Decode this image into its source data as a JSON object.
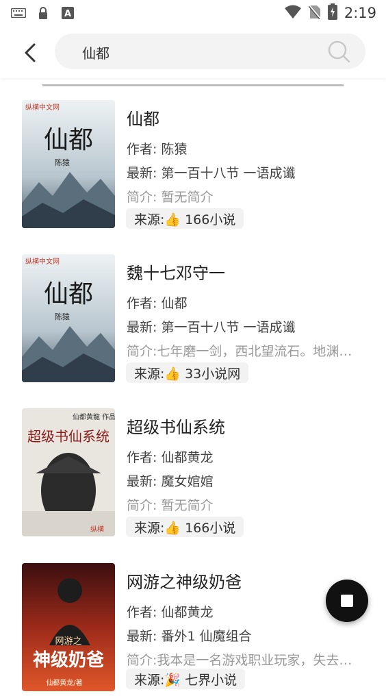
{
  "status_bar": {
    "time": "2:19",
    "left_icons": [
      "keyboard-icon",
      "lock-icon",
      "font-icon"
    ],
    "right_icons": [
      "wifi-icon",
      "no-sim-icon",
      "battery-charging-icon"
    ]
  },
  "header": {
    "search_value": "仙都"
  },
  "results": [
    {
      "title": "仙都",
      "author": "作者: 陈猿",
      "latest": "最新: 第一百十八节 一语成谶",
      "intro": "简介: 暂无简介",
      "source": "来源:👍 166小说",
      "cover": {
        "top": "纵横中文网",
        "main": "仙都",
        "author": "陈猿"
      }
    },
    {
      "title": "魏十七邓守一",
      "author": "作者: 仙都",
      "latest": "最新: 第一百十八节 一语成谶",
      "intro": "简介:七年磨一剑，西北望流石。地渊…",
      "source": "来源:👍 33小说网",
      "cover": {
        "top": "纵横中文网",
        "main": "仙都",
        "author": "陈猿"
      }
    },
    {
      "title": "超级书仙系统",
      "author": "作者: 仙都黄龙",
      "latest": "最新: 魔女婠婠",
      "intro": "简介: 暂无简介",
      "source": "来源:👍 166小说",
      "cover": {
        "top": "仙都黄龍 作品",
        "main": "超级书仙系统",
        "author": "纵横"
      }
    },
    {
      "title": "网游之神级奶爸",
      "author": "作者: 仙都黄龙",
      "latest": "最新: 番外1 仙魔组合",
      "intro": "简介:我本是一名游戏职业玩家，失去…",
      "source": "来源:🎉 七界小说",
      "cover": {
        "top": "网游之",
        "main": "神级奶爸",
        "author": "仙都黄龙/著"
      }
    }
  ],
  "colors": {
    "fab": "#111111",
    "source_bg": "#f2f2f2",
    "search_bg": "#f3f3f3"
  }
}
